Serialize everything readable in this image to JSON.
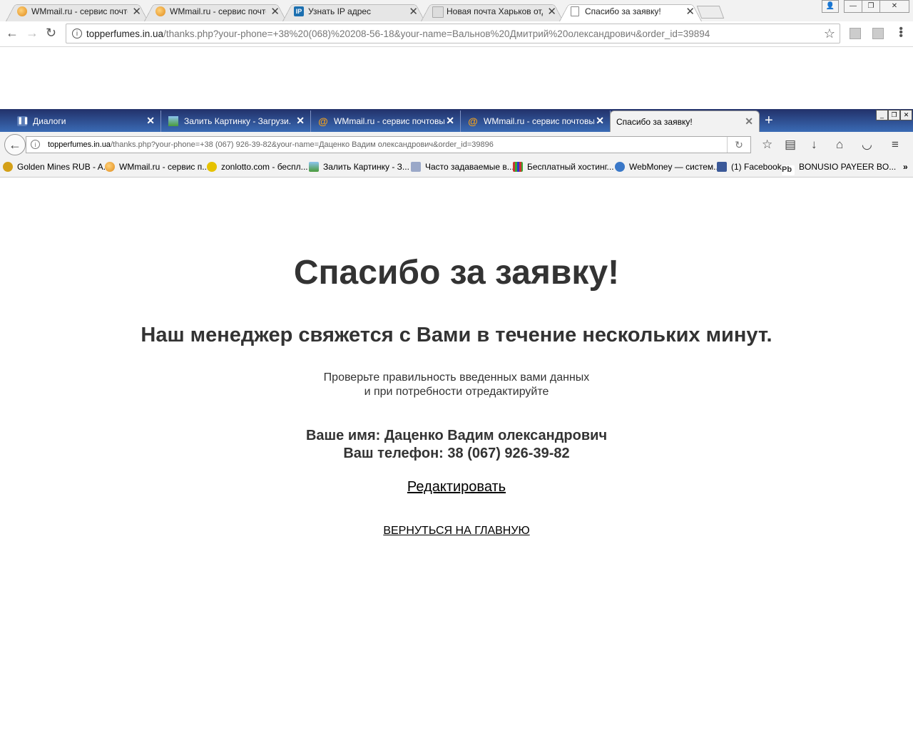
{
  "chrome": {
    "tabs": [
      {
        "title": "WMmail.ru - сервис почтов",
        "icon": "wmmail-icon"
      },
      {
        "title": "WMmail.ru - сервис почтов",
        "icon": "wmmail-icon"
      },
      {
        "title": "Узнать IP адрес",
        "icon": "ip-icon",
        "icon_text": "IP"
      },
      {
        "title": "Новая почта Харьков отд",
        "icon": "novaposhta-icon"
      },
      {
        "title": "Спасибо за заявку!",
        "icon": "document-icon"
      }
    ],
    "url_host": "topperfumes.in.ua",
    "url_path": "/thanks.php?your-phone=+38%20(068)%20208-56-18&your-name=Вальнов%20Дмитрий%20олександрович&order_id=39894"
  },
  "firefox": {
    "tabs": [
      {
        "title": "Диалоги",
        "icon": "pause-icon"
      },
      {
        "title": "Залить Картинку - Загрузи...",
        "icon": "image-icon"
      },
      {
        "title": "WMmail.ru - сервис почтовы...",
        "icon": "wmmail-icon"
      },
      {
        "title": "WMmail.ru - сервис почтовы...",
        "icon": "wmmail-icon"
      },
      {
        "title": "Спасибо за заявку!",
        "icon": "none"
      }
    ],
    "url_host": "topperfumes.in.ua",
    "url_path": "/thanks.php?your-phone=+38 (067) 926-39-82&your-name=Даценко Вадим олександрович&order_id=39896",
    "bookmarks": [
      {
        "label": "Golden Mines RUB - A...",
        "icon": "coin-icon"
      },
      {
        "label": "WMmail.ru - сервис п...",
        "icon": "wmmail-icon"
      },
      {
        "label": "zonlotto.com - беспл...",
        "icon": "zonlotto-icon"
      },
      {
        "label": "Залить Картинку - З...",
        "icon": "image-icon"
      },
      {
        "label": "Часто задаваемые в...",
        "icon": "faq-icon"
      },
      {
        "label": "Бесплатный хостинг...",
        "icon": "hosting-icon"
      },
      {
        "label": "WebMoney — систем...",
        "icon": "globe-icon"
      },
      {
        "label": "(1) Facebook",
        "icon": "facebook-icon"
      },
      {
        "label": "BONUSIO PAYEER BO...",
        "icon": "payeer-icon"
      }
    ]
  },
  "page": {
    "title": "Спасибо за заявку!",
    "subtitle": "Наш менеджер свяжется с Вами в течение нескольких минут.",
    "check_line1": "Проверьте правильность введенных вами данных",
    "check_line2": "и при потребности отредактируйте",
    "name_line": "Ваше имя: Даценко Вадим олександрович",
    "phone_line": "Ваш телефон: 38 (067) 926-39-82",
    "edit_link": "Редактировать",
    "home_link": "ВЕРНУТЬСЯ НА ГЛАВНУЮ"
  },
  "colors": {
    "ff_tabstrip_top": "#22316a",
    "ff_tabstrip_bottom": "#3a6bb5",
    "page_text": "#333333"
  }
}
